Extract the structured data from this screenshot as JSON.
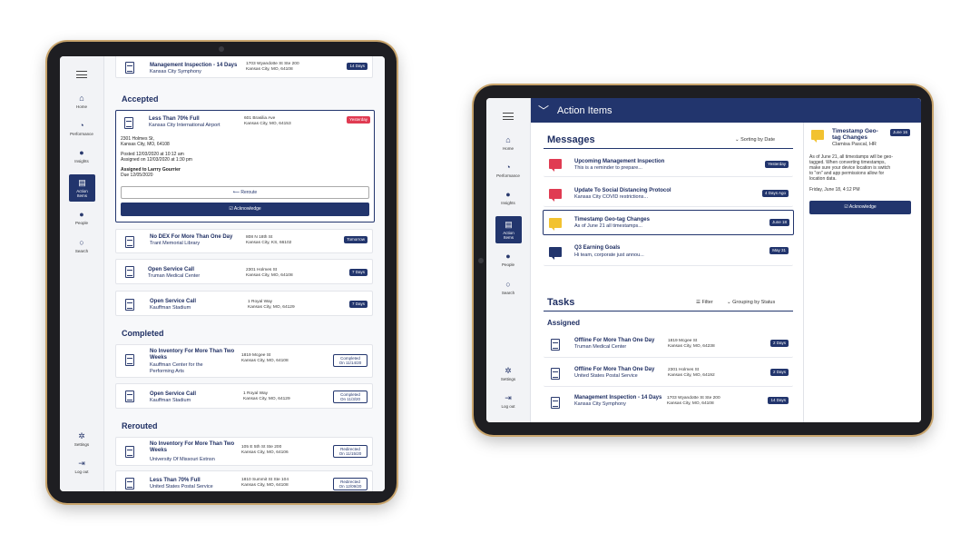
{
  "left": {
    "nav": {
      "home": "Home",
      "performance": "Performance",
      "insights": "Insights",
      "action_items": "Action Items",
      "people": "People",
      "search": "Search",
      "settings": "Settings",
      "logout": "Log out"
    },
    "top_card": {
      "title": "Management Inspection - 14 Days",
      "subtitle": "Kansas City Symphony",
      "addr1": "1703 Wyandotte St Ste 200",
      "addr2": "Kansas City, MO, 64108",
      "badge": "14 Days"
    },
    "accepted_label": "Accepted",
    "expanded": {
      "title": "Less Than 70% Full",
      "subtitle": "Kansas City International Airport",
      "addr1": "601 Brasilia Ave",
      "addr2": "Kansas City, MO, 64153",
      "badge": "Yesterday",
      "loc1": "2301 Holmes St,",
      "loc2": "Kansas City, MO, 64108",
      "posted": "Posted 12/03/2020 at 10:12 am",
      "assigned": "Assigned on 12/03/2020 at 1:30 pm",
      "assigned_to": "Assigned to Larrry Gourrier",
      "due": "Due 12/05/2020",
      "reroute": "Reroute",
      "acknowledge": "Acknowledge"
    },
    "accepted": [
      {
        "title": "No DEX For More Than One Day",
        "subtitle": "Trant Memorial Library",
        "addr1": "808 N 18th St",
        "addr2": "Kansas City, KS, 66102",
        "badge": "Tomorrow"
      },
      {
        "title": "Open Service Call",
        "subtitle": "Truman Medical Center",
        "addr1": "2301 Holmes St",
        "addr2": "Kansas City, MO, 64108",
        "badge": "7 Days"
      },
      {
        "title": "Open Service Call",
        "subtitle": "Kauffman Stadium",
        "addr1": "1 Royal Way",
        "addr2": "Kansas City, MO, 64129",
        "badge": "7 Days"
      }
    ],
    "completed_label": "Completed",
    "completed": [
      {
        "title1": "No Inventory For More Than Two",
        "title2": "Weeks",
        "subtitle1": "Kauffman Center for the",
        "subtitle2": "Performing Arts",
        "addr1": "1819 Mcgee St",
        "addr2": "Kansas City, MO, 64108",
        "badge1": "Completed",
        "badge2": "On 11/14/20"
      },
      {
        "title1": "Open Service Call",
        "title2": "",
        "subtitle1": "Kauffman Stadium",
        "subtitle2": "",
        "addr1": "1 Royal Way",
        "addr2": "Kansas City, MO, 64129",
        "badge1": "Completed",
        "badge2": "On 11/3/20"
      }
    ],
    "rerouted_label": "Rerouted",
    "rerouted": [
      {
        "title1": "No Inventory For More Than Two",
        "title2": "Weeks",
        "subtitle1": "University Of Missouri Extnsn",
        "addr1": "105 E 5th St Ste 200",
        "addr2": "Kansas City, MO, 64106",
        "badge1": "Redirected",
        "badge2": "On 11/15/20"
      },
      {
        "title1": "Less Than 70% Full",
        "title2": "",
        "subtitle1": "United States Postal Service",
        "addr1": "1810 Summit St Ste 104",
        "addr2": "Kansas City, MO, 64108",
        "badge1": "Redirected",
        "badge2": "On 12/09/20"
      }
    ]
  },
  "right": {
    "header_title": "Action Items",
    "messages_label": "Messages",
    "sort_label": "Sorting by Date",
    "messages": [
      {
        "title": "Upcoming Management Inspection",
        "preview": "This is a reminder to prepare...",
        "badge": "Yesterday",
        "icon": "alert-red"
      },
      {
        "title": "Update To Social Distancing Protocol",
        "preview": "Kansas City COVID restrictions...",
        "badge": "4 Days Ago",
        "icon": "alert-red"
      },
      {
        "title": "Timestamp Geo-tag Changes",
        "preview": "As of June 21 all timestamps...",
        "badge": "June 18",
        "icon": "alert-yellow"
      },
      {
        "title": "Q3 Earning Goals",
        "preview": "Hi team, corporate just annou...",
        "badge": "May 31",
        "icon": "message-blue"
      }
    ],
    "tasks_label": "Tasks",
    "filter_label": "Filter",
    "group_label": "Grouping by Status",
    "assigned_label": "Assigned",
    "tasks": [
      {
        "title": "Offline For More Than One Day",
        "subtitle": "Truman Medical Center",
        "addr1": "1819 Mcgee St",
        "addr2": "Kansas City, MO, 64238",
        "badge": "2 Days"
      },
      {
        "title": "Offline For More Than One Day",
        "subtitle": "United States Postal Service",
        "addr1": "2301 Holmes St",
        "addr2": "Kansas City, MO, 64192",
        "badge": "2 Days"
      },
      {
        "title": "Management Inspection - 14 Days",
        "subtitle": "Kansas City Symphony",
        "addr1": "1703 Wyandotte St Ste 200",
        "addr2": "Kansas City, MO, 64108",
        "badge": "14 Days"
      }
    ],
    "detail": {
      "title1": "Timestamp Geo-",
      "title2": "tag Changes",
      "from": "Clamisa Pascal, HR",
      "badge": "June 16",
      "body": [
        "As of June 21, all timestamps will be geo-",
        "tagged. When converting timestamps,",
        "make sure your device location is switch",
        "to \"on\" and app permissions allow for",
        "location data."
      ],
      "date": "Friday, June 18, 4:12 PM",
      "acknowledge": "Acknowledge"
    },
    "nav": {
      "home": "Home",
      "performance": "Performance",
      "insights": "Insights",
      "action_items": "Action Items",
      "people": "People",
      "search": "Search",
      "settings": "Settings",
      "logout": "Log out"
    }
  },
  "colors": {
    "navy": "#22356d",
    "red": "#e03b52",
    "yellow": "#f2c230",
    "bezel_gold": "#c9a56d"
  }
}
